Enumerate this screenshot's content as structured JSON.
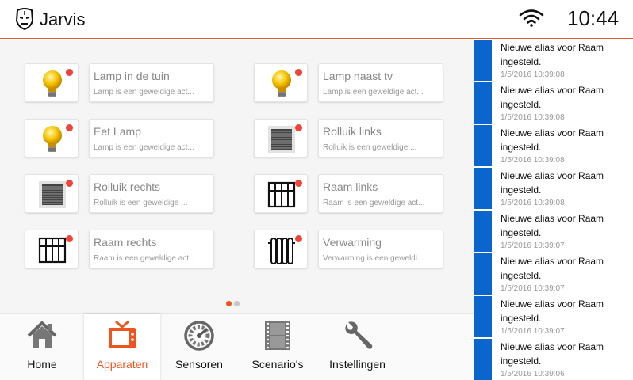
{
  "header": {
    "title": "Jarvis",
    "time": "10:44",
    "logo_icon": "iron-man-mask-icon",
    "status_icon": "wifi-icon"
  },
  "devices": [
    {
      "name": "Lamp in de tuin",
      "desc": "Lamp is een geweldige act...",
      "icon": "lightbulb-icon"
    },
    {
      "name": "Lamp naast tv",
      "desc": "Lamp is een geweldige act...",
      "icon": "lightbulb-icon"
    },
    {
      "name": "Eet Lamp",
      "desc": "Lamp is een geweldige act...",
      "icon": "lightbulb-icon"
    },
    {
      "name": "Rolluik links",
      "desc": "Rolluik is een geweldige ...",
      "icon": "shutter-icon"
    },
    {
      "name": "Rolluik rechts",
      "desc": "Rolluik is een geweldige ...",
      "icon": "shutter-icon"
    },
    {
      "name": "Raam links",
      "desc": "Raam is een geweldige act...",
      "icon": "window-icon"
    },
    {
      "name": "Raam rechts",
      "desc": "Raam is een geweldige act...",
      "icon": "window-icon"
    },
    {
      "name": "Verwarming",
      "desc": "Verwarming is een geweldi...",
      "icon": "radiator-icon"
    }
  ],
  "pager": {
    "current": 1,
    "total": 2
  },
  "nav": [
    {
      "label": "Home",
      "icon": "home-icon",
      "active": false
    },
    {
      "label": "Apparaten",
      "icon": "tv-icon",
      "active": true
    },
    {
      "label": "Sensoren",
      "icon": "gauge-icon",
      "active": false
    },
    {
      "label": "Scenario's",
      "icon": "film-icon",
      "active": false
    },
    {
      "label": "Instellingen",
      "icon": "wrench-icon",
      "active": false
    }
  ],
  "log": [
    {
      "text": "Nieuwe alias voor Raam ingesteld.",
      "time": "1/5/2016 10:39:08"
    },
    {
      "text": "Nieuwe alias voor Raam ingesteld.",
      "time": "1/5/2016 10:39:08"
    },
    {
      "text": "Nieuwe alias voor Raam ingesteld.",
      "time": "1/5/2016 10:39:08"
    },
    {
      "text": "Nieuwe alias voor Raam ingesteld.",
      "time": "1/5/2016 10:39:08"
    },
    {
      "text": "Nieuwe alias voor Raam ingesteld.",
      "time": "1/5/2016 10:39:07"
    },
    {
      "text": "Nieuwe alias voor Raam ingesteld.",
      "time": "1/5/2016 10:39:07"
    },
    {
      "text": "Nieuwe alias voor Raam ingesteld.",
      "time": "1/5/2016 10:39:07"
    },
    {
      "text": "Nieuwe alias voor Raam ingesteld.",
      "time": "1/5/2016 10:39:06"
    }
  ],
  "colors": {
    "accent": "#f0541e",
    "log_bar": "#0a66cc",
    "status_dot": "#f0443a"
  }
}
